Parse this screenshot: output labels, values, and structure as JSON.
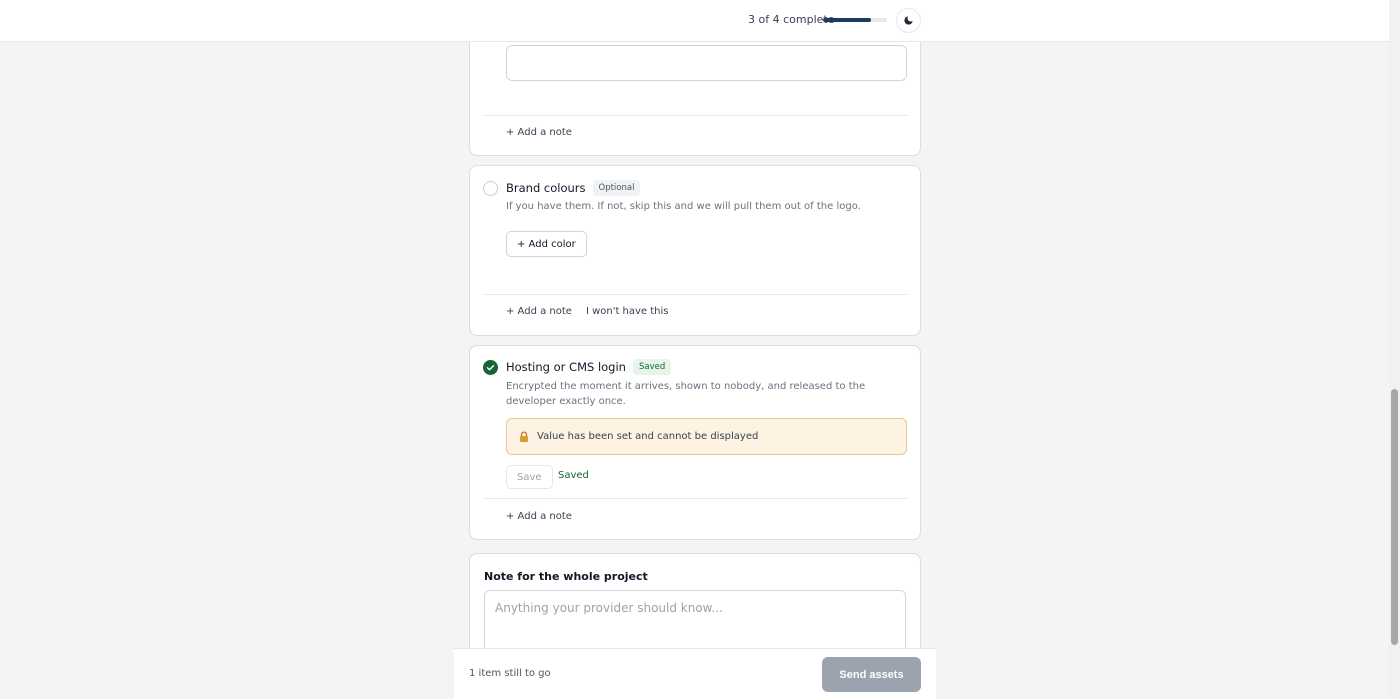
{
  "header": {
    "progress_text": "3 of 4 complete",
    "progress_fraction": 0.75,
    "theme_toggle_icon": "moon-icon"
  },
  "cards": [
    {
      "add_note_label": "+  Add a note"
    },
    {
      "title": "Brand colours",
      "badge": "Optional",
      "description": "If you have them. If not, skip this and we will pull them out of the logo.",
      "add_color_label": "+ Add color",
      "add_note_label": "+  Add a note",
      "wont_have_label": "I won't have this"
    },
    {
      "title": "Hosting or CMS login",
      "badge": "Saved",
      "description": "Encrypted the moment it arrives, shown to nobody, and released to the developer exactly once.",
      "secret_message": "Value has been set and cannot be displayed",
      "save_label": "Save",
      "saved_status": "Saved",
      "add_note_label": "+  Add a note"
    }
  ],
  "project_note": {
    "label": "Note for the whole project",
    "placeholder": "Anything your provider should know..."
  },
  "footer": {
    "remaining_text": "1 item still to go",
    "send_label": "Send assets"
  },
  "colors": {
    "accent": "#1e3a5f",
    "success": "#166534",
    "warning_bg": "#fef3e2",
    "disabled_button": "#9aa3ae"
  }
}
